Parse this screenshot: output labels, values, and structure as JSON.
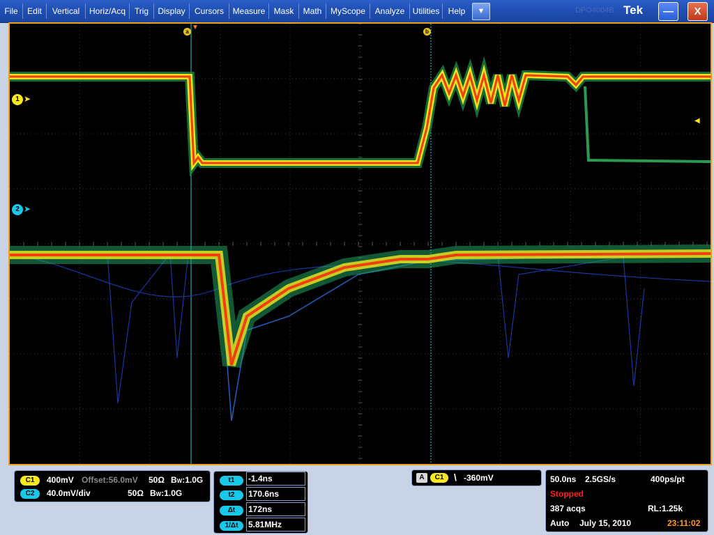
{
  "menu": {
    "items": [
      "File",
      "Edit",
      "Vertical",
      "Horiz/Acq",
      "Trig",
      "Display",
      "Cursors",
      "Measure",
      "Mask",
      "Math",
      "MyScope",
      "Analyze",
      "Utilities",
      "Help"
    ],
    "dropdown_glyph": "▼",
    "ghost_label": "DPO4004B",
    "logo": "Tek",
    "minimize_glyph": "—",
    "close_glyph": "X"
  },
  "display": {
    "channel_markers": [
      "1",
      "2"
    ],
    "cursor_tags": [
      "a",
      "b"
    ],
    "colors": {
      "ch1": "#f8e81c",
      "ch2": "#18c8e8",
      "frame": "#f0a020",
      "cursor": "#20c8e0"
    }
  },
  "vertical": {
    "ch1": {
      "badge": "C1",
      "scale": "400mV",
      "offset_label": "Offset:56.0mV",
      "impedance": "50Ω",
      "bw_prefix": "B",
      "bw_sub": "W",
      "bw_value": ":1.0G"
    },
    "ch2": {
      "badge": "C2",
      "scale": "40.0mV/div",
      "impedance": "50Ω",
      "bw_prefix": "B",
      "bw_sub": "W",
      "bw_value": ":1.0G"
    }
  },
  "cursors": {
    "rows": [
      {
        "label": "t1",
        "value": "-1.4ns"
      },
      {
        "label": "t2",
        "value": "170.6ns"
      },
      {
        "label": "Δt",
        "value": "172ns"
      },
      {
        "label": "1/Δt",
        "value": "5.81MHz"
      }
    ]
  },
  "trigger": {
    "mode_badge": "A",
    "source": "C1",
    "slope_glyph": "\\",
    "level": "-360mV"
  },
  "acquisition": {
    "horizontal_scale": "50.0ns",
    "sample_rate": "2.5GS/s",
    "resolution": "400ps/pt",
    "state": "Stopped",
    "acqs": "387 acqs",
    "record_length": "RL:1.25k",
    "trigger_mode": "Auto",
    "date": "July 15, 2010",
    "time": "23:11:02"
  }
}
